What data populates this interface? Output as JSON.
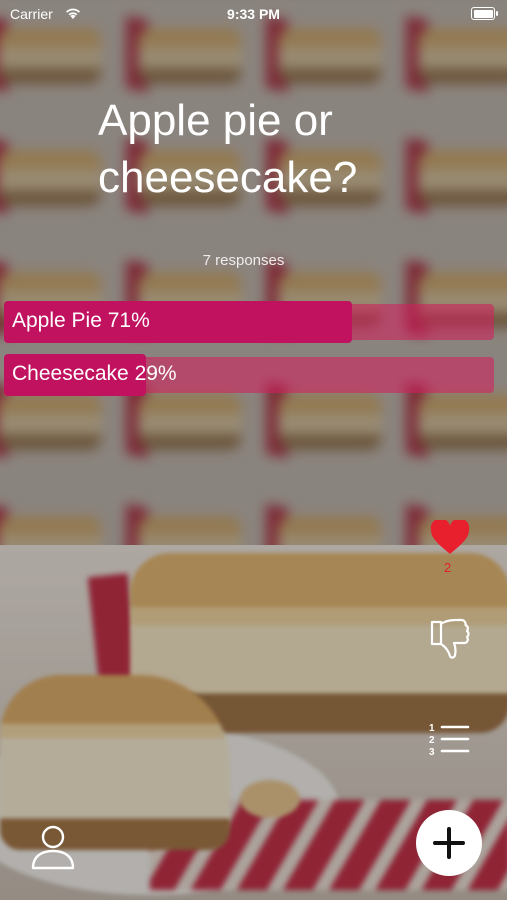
{
  "status_bar": {
    "carrier": "Carrier",
    "time": "9:33 PM"
  },
  "poll": {
    "question": "Apple pie or cheesecake?",
    "responses_label": "7 responses",
    "options": [
      {
        "label": "Apple Pie 71%",
        "percent": 71
      },
      {
        "label": "Cheesecake 29%",
        "percent": 29
      }
    ]
  },
  "actions": {
    "like_count": "2",
    "icons": [
      "heart-icon",
      "thumbs-down-icon",
      "numbered-list-icon",
      "plus-icon",
      "person-icon"
    ]
  },
  "colors": {
    "accent": "#c0125f",
    "heart": "#e8202e"
  }
}
